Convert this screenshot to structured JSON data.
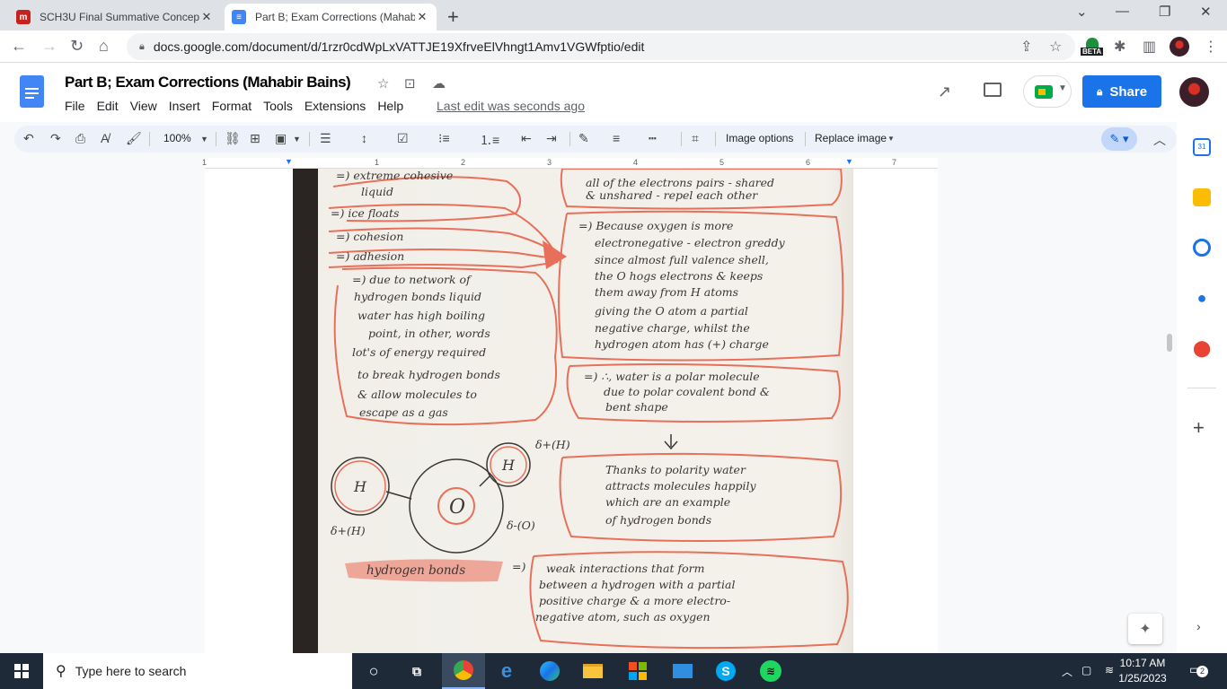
{
  "browser": {
    "tabs": [
      {
        "title": "SCH3U Final Summative Concept",
        "active": false,
        "favicon_color": "#c5221f"
      },
      {
        "title": "Part B; Exam Corrections (Mahab",
        "active": true,
        "favicon_color": "#4285f4"
      }
    ],
    "url": "docs.google.com/document/d/1rzr0cdWpLxVATTJE19XfrveElVhngt1Amv1VGWfptio/edit",
    "beta_label": "BETA"
  },
  "doc": {
    "title": "Part B; Exam Corrections (Mahabir Bains)",
    "menu": [
      "File",
      "Edit",
      "View",
      "Insert",
      "Format",
      "Tools",
      "Extensions",
      "Help"
    ],
    "last_edit": "Last edit was seconds ago",
    "share_label": "Share"
  },
  "toolbar": {
    "zoom": "100%",
    "image_options": "Image options",
    "replace_image": "Replace image"
  },
  "ruler": {
    "numbers": [
      "1",
      "1",
      "2",
      "3",
      "4",
      "5",
      "6",
      "7"
    ]
  },
  "notes": {
    "left": [
      "=) extreme cohesive",
      "liquid",
      "=) ice floats",
      "=) cohesion",
      "=) adhesion",
      "=) due to network of",
      "hydrogen bonds liquid",
      "water has high boiling",
      "point, in other, words",
      "lot's of energy required",
      "to break hydrogen bonds",
      "& allow molecules to",
      "escape as a gas"
    ],
    "right_top": [
      "all of the electrons pairs - shared",
      "& unshared - repel each other"
    ],
    "right_mid": [
      "=) Because oxygen is more",
      "electronegative - electron greddy",
      "since almost full valence shell,",
      "the O hogs electrons & keeps",
      "them away from H atoms",
      "giving the O atom a partial",
      "negative charge, whilst the",
      "hydrogen atom has (+) charge"
    ],
    "right_conclusion": [
      "=) ∴, water is a polar molecule",
      "due to polar covalent bond &",
      "bent shape"
    ],
    "right_polarity": [
      "Thanks to polarity water",
      "attracts molecules happily",
      "which are an example",
      "of hydrogen bonds"
    ],
    "molecule": {
      "atom_h": "H",
      "atom_o": "O",
      "label_h_top": "δ+(H)",
      "label_h_left": "δ+(H)",
      "label_o": "δ-(O)"
    },
    "hydrogen_bonds_label": "hydrogen bonds",
    "hydrogen_bonds_arrow": "=)",
    "hydrogen_bonds_def": [
      "weak interactions that form",
      "between a hydrogen with a partial",
      "positive charge & a more electro-",
      "negative atom, such as oxygen"
    ]
  },
  "taskbar": {
    "search_placeholder": "Type here to search",
    "time": "10:17 AM",
    "date": "1/25/2023",
    "notification_count": "2"
  },
  "colors": {
    "accent": "#1a73e8",
    "ink_orange": "#e8705a",
    "taskbar": "#1f2a38"
  }
}
